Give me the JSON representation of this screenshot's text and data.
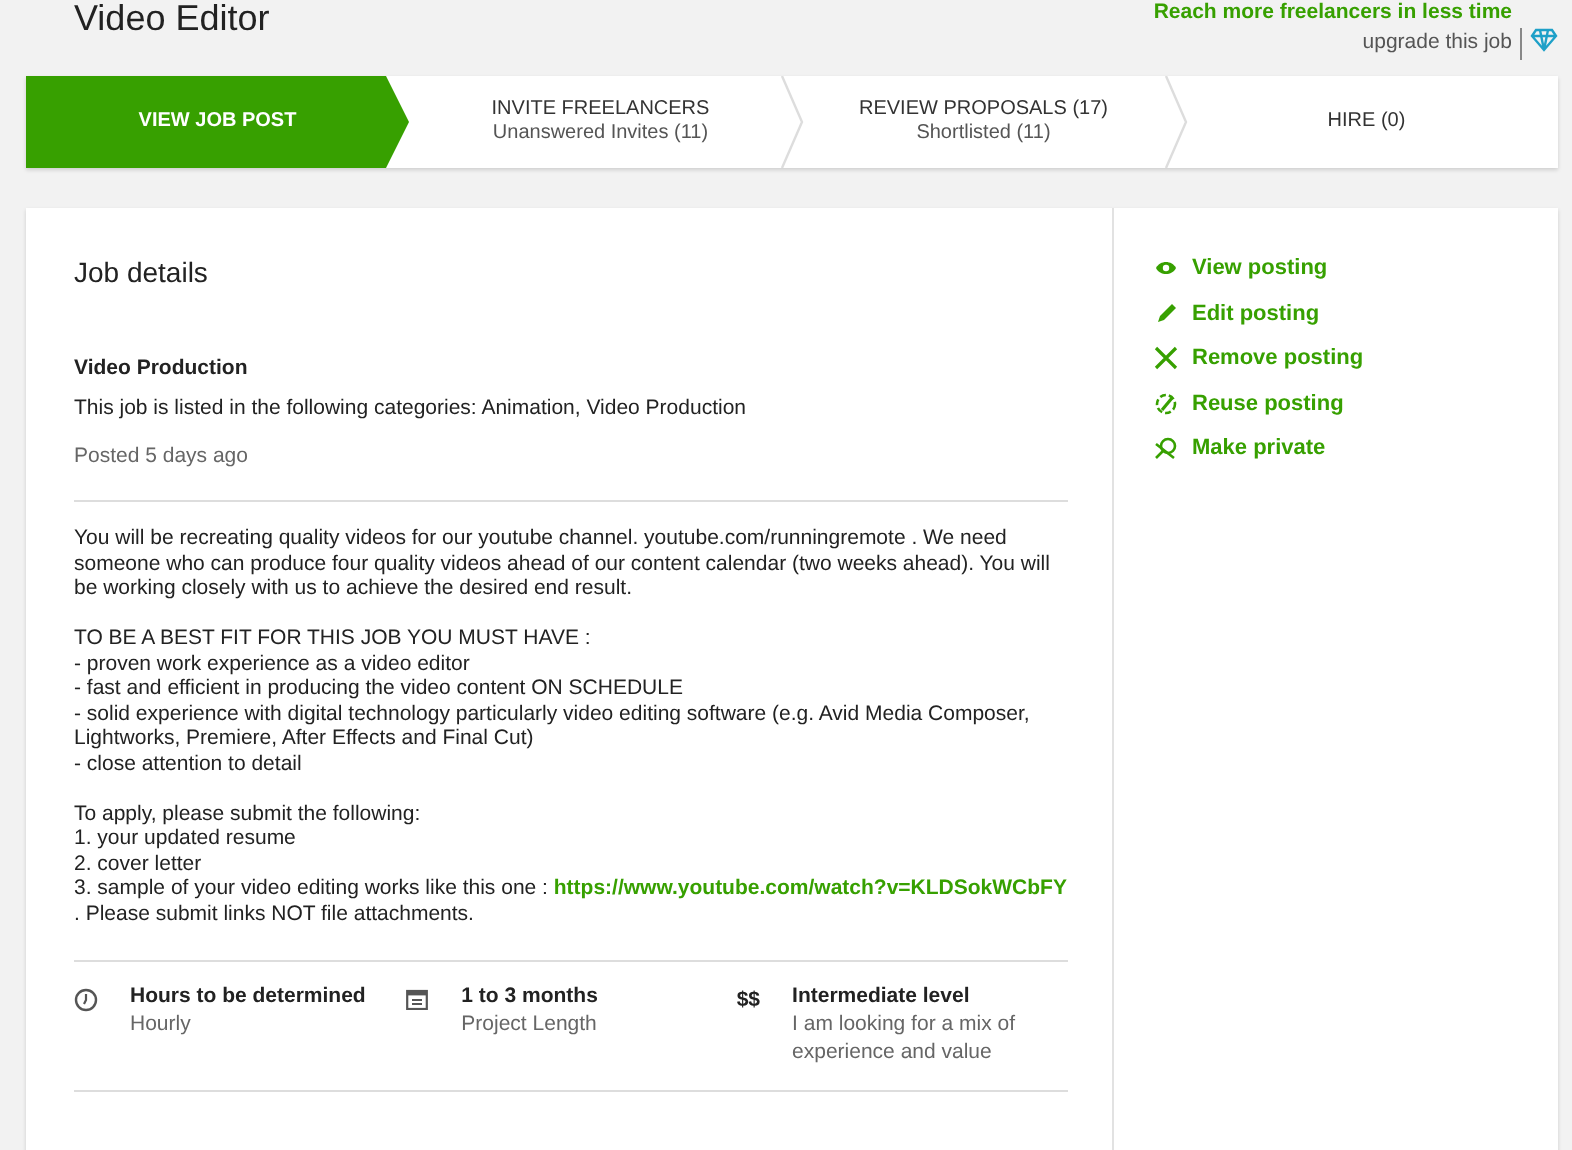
{
  "page_title": "Video Editor",
  "upgrade": {
    "promo": "Reach more freelancers in less time",
    "link": "upgrade this job"
  },
  "steps": [
    {
      "label": "VIEW JOB POST",
      "selected": true
    },
    {
      "label": "INVITE FREELANCERS",
      "sub": "Unanswered Invites (11)",
      "selected": false
    },
    {
      "label": "REVIEW PROPOSALS (17)",
      "sub": "Shortlisted (11)",
      "selected": false
    },
    {
      "label": "HIRE (0)",
      "selected": false
    }
  ],
  "job": {
    "heading": "Job details",
    "category": "Video Production",
    "categories_text": "This job is listed in the following categories: Animation, Video Production",
    "posted": "Posted 5 days ago",
    "description": [
      {
        "lines": [
          "You will be recreating quality videos for our youtube channel. youtube.com/runningremote . We need someone who can produce four quality videos ahead of our content calendar (two weeks ahead). You will be working closely with us to achieve the desired end result."
        ]
      },
      {
        "lines": [
          "TO BE A BEST FIT FOR THIS JOB YOU MUST HAVE :",
          "- proven work experience as a video editor",
          "- fast and efficient in producing the video content ON SCHEDULE",
          "- solid experience with digital technology particularly video editing software  (e.g. Avid Media Composer, Lightworks, Premiere, After Effects and Final Cut)",
          "- close attention to detail"
        ]
      },
      {
        "lines": [
          "To apply, please submit the following:",
          "1. your updated resume",
          "2. cover letter"
        ],
        "last": {
          "text": "3. sample of your video editing works like this one : ",
          "link": "https://www.youtube.com/watch?v=KLDSokWCbFY",
          "after": " . Please submit links NOT file attachments."
        }
      }
    ],
    "facts": [
      {
        "kind": "clock",
        "title": "Hours to be determined",
        "sub": "Hourly"
      },
      {
        "kind": "calendar",
        "title": "1 to 3 months",
        "sub": "Project Length"
      },
      {
        "kind": "money",
        "icon_text": "$$",
        "title": "Intermediate level",
        "sub": "I am looking for a mix of experience and value"
      }
    ]
  },
  "actions": [
    {
      "kind": "eye",
      "label": "View posting"
    },
    {
      "kind": "pencil",
      "label": "Edit posting"
    },
    {
      "kind": "cross",
      "label": "Remove posting"
    },
    {
      "kind": "reuse",
      "label": "Reuse posting"
    },
    {
      "kind": "private",
      "label": "Make private"
    }
  ]
}
